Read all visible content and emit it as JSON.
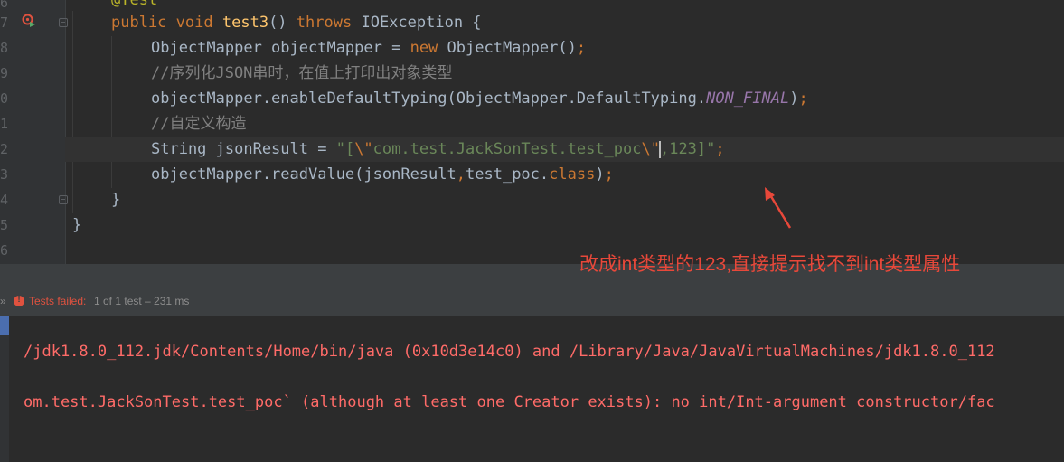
{
  "gutter": {
    "line_numbers": [
      "6",
      "7",
      "8",
      "9",
      "0",
      "1",
      "2",
      "3",
      "4",
      "5",
      "6"
    ]
  },
  "code": {
    "l0_annotation": "@Test",
    "l1_kw_public": "public",
    "l1_kw_void": "void",
    "l1_method": "test3",
    "l1_parens": "()",
    "l1_kw_throws": "throws",
    "l1_rest": "IOException {",
    "l2_a": "ObjectMapper objectMapper = ",
    "l2_kw_new": "new",
    "l2_b": " ObjectMapper()",
    "l2_semi": ";",
    "l3_comment": "//序列化JSON串时，在值上打印出对象类型",
    "l4_a": "objectMapper.enableDefaultTyping(ObjectMapper.DefaultTyping.",
    "l4_const": "NON_FINAL",
    "l4_b": ")",
    "l4_semi": ";",
    "l5_comment": "//自定义构造",
    "l6_a": "String jsonResult = ",
    "l6_str1": "\"[",
    "l6_esc1": "\\\"",
    "l6_str2": "com.test.JackSonTest.test_poc",
    "l6_esc2": "\\\"",
    "l6_str3": ",123]\"",
    "l6_semi": ";",
    "l7_a": "objectMapper.readValue(jsonResult",
    "l7_comma": ",",
    "l7_b": "test_poc.",
    "l7_kw_class": "class",
    "l7_c": ")",
    "l7_semi": ";",
    "l8_brace": "}",
    "l9_brace": "}"
  },
  "annotation": {
    "text": "改成int类型的123,直接提示找不到int类型属性",
    "color": "#e8483a"
  },
  "test_status": {
    "chevron": "»",
    "failed_label": "Tests failed:",
    "failed_count": "1 of 1 test – 231 ms",
    "fail_color": "#e0523f"
  },
  "console": {
    "line1": "/jdk1.8.0_112.jdk/Contents/Home/bin/java (0x10d3e14c0) and /Library/Java/JavaVirtualMachines/jdk1.8.0_112",
    "line2": "om.test.JackSonTest.test_poc` (although at least one Creator exists): no int/Int-argument constructor/fac",
    "error_color": "#ff6b68"
  },
  "icons": {
    "run": "run-test-failed-icon",
    "fold": "fold-icon",
    "fail": "error-icon"
  }
}
